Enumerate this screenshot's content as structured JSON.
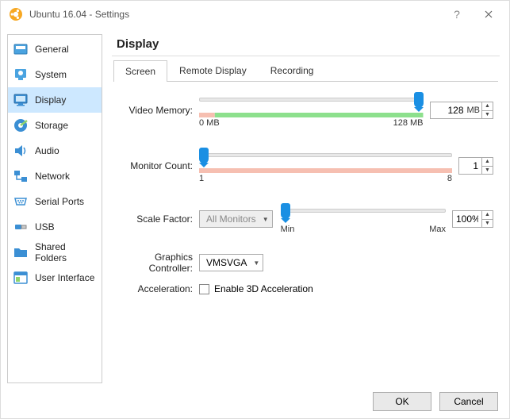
{
  "window": {
    "title": "Ubuntu 16.04 - Settings"
  },
  "sidebar": {
    "items": [
      {
        "label": "General"
      },
      {
        "label": "System"
      },
      {
        "label": "Display"
      },
      {
        "label": "Storage"
      },
      {
        "label": "Audio"
      },
      {
        "label": "Network"
      },
      {
        "label": "Serial Ports"
      },
      {
        "label": "USB"
      },
      {
        "label": "Shared Folders"
      },
      {
        "label": "User Interface"
      }
    ]
  },
  "page": {
    "title": "Display"
  },
  "tabs": {
    "screen": "Screen",
    "remote": "Remote Display",
    "recording": "Recording"
  },
  "form": {
    "video_memory": {
      "label": "Video Memory:",
      "value": "128",
      "unit": "MB",
      "min_tick": "0 MB",
      "max_tick": "128 MB"
    },
    "monitor_count": {
      "label": "Monitor Count:",
      "value": "1",
      "min_tick": "1",
      "max_tick": "8"
    },
    "scale_factor": {
      "label": "Scale Factor:",
      "select": "All Monitors",
      "value": "100%",
      "min_tick": "Min",
      "max_tick": "Max"
    },
    "graphics_controller": {
      "label": "Graphics Controller:",
      "value": "VMSVGA"
    },
    "acceleration": {
      "label": "Acceleration:",
      "checkbox": "Enable 3D Acceleration"
    }
  },
  "footer": {
    "ok": "OK",
    "cancel": "Cancel"
  }
}
